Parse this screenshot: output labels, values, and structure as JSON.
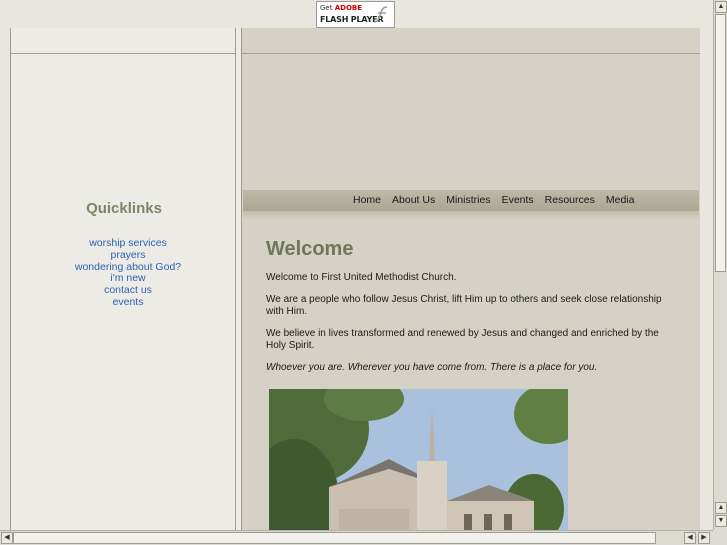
{
  "flash_badge": {
    "line1_prefix": "Get",
    "line1_brand": "ADOBE",
    "line2": "FLASH PLAYER"
  },
  "quicklinks": {
    "title": "Quicklinks",
    "links": [
      "worship services",
      "prayers",
      "wondering about God?",
      "i'm new",
      "contact us",
      "events"
    ]
  },
  "nav": {
    "items": [
      "Home",
      "About Us",
      "Ministries",
      "Events",
      "Resources",
      "Media"
    ]
  },
  "main": {
    "heading": "Welcome",
    "p1": "Welcome to First United Methodist Church.",
    "p2": "We are a people who follow Jesus Christ, lift Him up to others and seek close relationship with Him.",
    "p3": "We believe in lives transformed and renewed by Jesus and changed and enriched by the Holy Spirit.",
    "p4": "Whoever you are.  Wherever you have come from. There is a place for you."
  }
}
